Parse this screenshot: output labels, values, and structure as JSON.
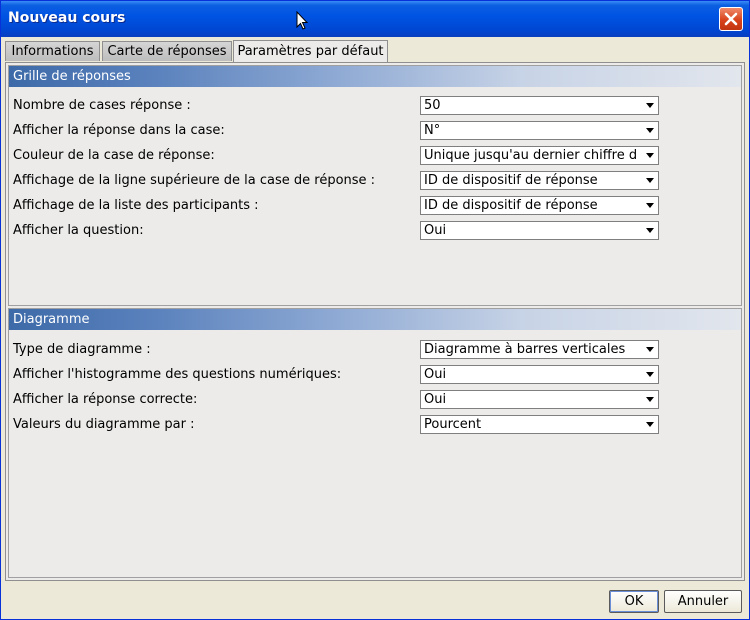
{
  "window": {
    "title": "Nouveau cours"
  },
  "tabs": [
    {
      "label": "Informations"
    },
    {
      "label": "Carte de réponses"
    },
    {
      "label": "Paramètres par défaut"
    }
  ],
  "grid_section": {
    "title": "Grille de réponses",
    "rows": [
      {
        "label": "Nombre de cases réponse :",
        "value": "50"
      },
      {
        "label": "Afficher la réponse dans la case:",
        "value": "N°"
      },
      {
        "label": "Couleur de la case de réponse:",
        "value": "Unique jusqu'au dernier chiffre de ..."
      },
      {
        "label": "Affichage de la ligne supérieure de la case de réponse :",
        "value": "ID de dispositif de réponse"
      },
      {
        "label": "Affichage de la liste des participants :",
        "value": "ID de dispositif de réponse"
      },
      {
        "label": "Afficher la question:",
        "value": "Oui"
      }
    ]
  },
  "chart_section": {
    "title": "Diagramme",
    "rows": [
      {
        "label": "Type de diagramme :",
        "value": "Diagramme à barres verticales"
      },
      {
        "label": "Afficher l'histogramme des questions numériques:",
        "value": "Oui"
      },
      {
        "label": "Afficher la réponse correcte:",
        "value": "Oui"
      },
      {
        "label": "Valeurs du diagramme par :",
        "value": "Pourcent"
      }
    ]
  },
  "buttons": {
    "ok": "OK",
    "cancel": "Annuler"
  },
  "colors": {
    "titlebar": "#0054e3",
    "close": "#d8431c",
    "section_header": "#3d6aa8"
  }
}
